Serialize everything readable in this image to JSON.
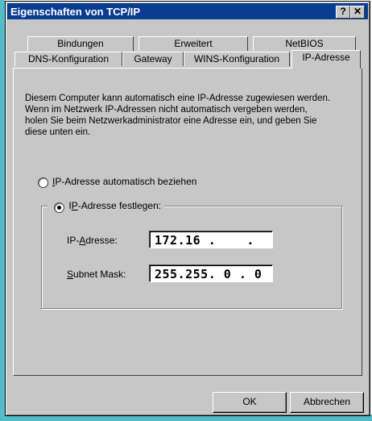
{
  "window": {
    "title": "Eigenschaften von TCP/IP",
    "help_glyph": "?",
    "close_glyph": "✕"
  },
  "tabs": {
    "row1": [
      {
        "label": "Bindungen"
      },
      {
        "label": "Erweitert"
      },
      {
        "label": "NetBIOS"
      }
    ],
    "row2": [
      {
        "label": "DNS-Konfiguration"
      },
      {
        "label": "Gateway"
      },
      {
        "label": "WINS-Konfiguration"
      },
      {
        "label": "IP-Adresse",
        "active": true
      }
    ]
  },
  "panel": {
    "description": "Diesem Computer kann automatisch eine IP-Adresse zugewiesen werden. Wenn im Netzwerk IP-Adressen nicht automatisch vergeben werden, holen Sie beim Netzwerkadministrator eine Adresse ein, und geben Sie diese unten ein.",
    "option_auto": {
      "label_first": "I",
      "label_rest": "P-Adresse automatisch beziehen",
      "checked": false
    },
    "option_manual": {
      "label_first": "I",
      "label_mid": "P",
      "label_rest": "-Adresse festlegen:",
      "checked": true
    },
    "ip_field": {
      "label_pre": "IP-",
      "label_key": "A",
      "label_rest": "dresse:",
      "value": "172.16 .    .   "
    },
    "subnet_field": {
      "label_key": "S",
      "label_rest": "ubnet Mask:",
      "value": "255.255. 0 . 0"
    }
  },
  "buttons": {
    "ok": "OK",
    "cancel": "Abbrechen"
  }
}
